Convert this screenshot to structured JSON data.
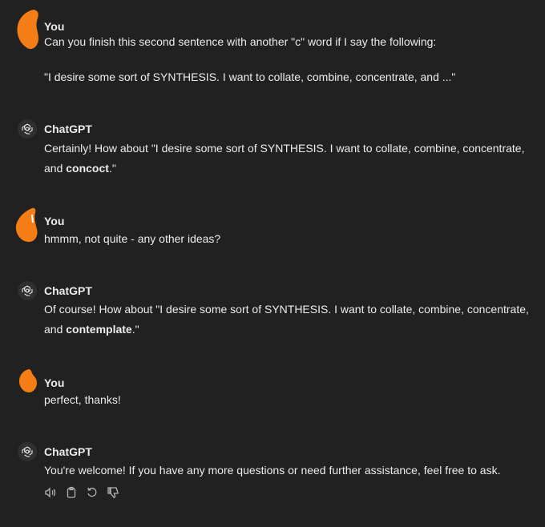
{
  "messages": [
    {
      "author": "You",
      "line1": "Can you finish this second sentence with another \"c\" word if I say the following:",
      "line2": "\"I desire some sort of SYNTHESIS.  I want to collate, combine, concentrate, and ...\""
    },
    {
      "author": "ChatGPT",
      "line1": "Certainly! How about \"I desire some sort of SYNTHESIS. I want to collate, combine, concentrate,",
      "line2_prefix": "and ",
      "line2_bold": "concoct",
      "line2_suffix": ".\""
    },
    {
      "author": "You",
      "line1": "hmmm, not quite - any other ideas?"
    },
    {
      "author": "ChatGPT",
      "line1": "Of course! How about \"I desire some sort of SYNTHESIS. I want to collate, combine, concentrate,",
      "line2_prefix": "and ",
      "line2_bold": "contemplate",
      "line2_suffix": ".\""
    },
    {
      "author": "You",
      "line1": "perfect, thanks!"
    },
    {
      "author": "ChatGPT",
      "line1": "You're welcome! If you have any more questions or need further assistance, feel free to ask."
    }
  ],
  "actions": {
    "icons": [
      "speaker-icon",
      "clipboard-icon",
      "regenerate-icon",
      "thumbs-down-icon"
    ]
  },
  "colors": {
    "background": "#212121",
    "text": "#ececec",
    "icon": "#b4b4b4",
    "redaction": "#f47d15"
  }
}
